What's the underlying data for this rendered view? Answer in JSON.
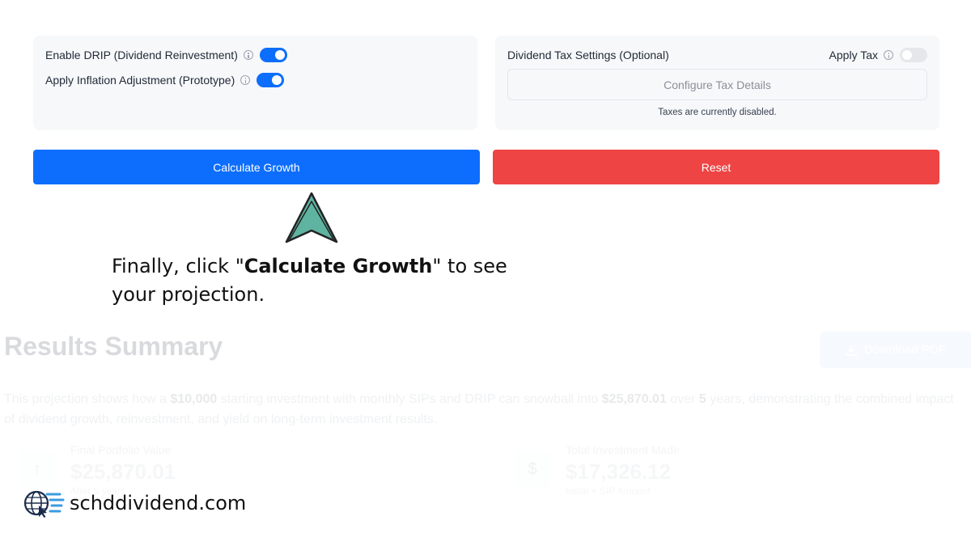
{
  "options": {
    "drip_label": "Enable DRIP (Dividend Reinvestment)",
    "drip_enabled": true,
    "inflation_label": "Apply Inflation Adjustment (Prototype)",
    "inflation_enabled": true
  },
  "tax": {
    "title": "Dividend Tax Settings (Optional)",
    "apply_label": "Apply Tax",
    "apply_enabled": false,
    "configure_label": "Configure Tax Details",
    "status": "Taxes are currently disabled."
  },
  "actions": {
    "calculate_label": "Calculate Growth",
    "reset_label": "Reset"
  },
  "hint": {
    "prefix": "Finally, click \"",
    "bold": "Calculate Growth",
    "suffix": "\" to see your projection."
  },
  "results": {
    "title": "Results Summary",
    "download_label": "Download PDF",
    "summary_1": "This projection shows how a ",
    "summary_amount_start": "$10,000",
    "summary_2": " starting investment with monthly SIPs and DRIP can snowball into ",
    "summary_amount_end": "$25,870.01",
    "summary_3": " over ",
    "summary_years": "5",
    "summary_4": " years, demonstrating the combined impact of dividend growth, reinvestment, and yield on long-term investment results.",
    "cards": [
      {
        "label": "Final Portfolio Value",
        "value": "$25,870.01",
        "sub": "After 5 years",
        "icon": "arrow-up-icon"
      },
      {
        "label": "Total Investment Made",
        "value": "$17,326.12",
        "sub": "Initial + SIP Amount",
        "icon": "dollar-icon"
      }
    ]
  },
  "watermark": {
    "text": "schddividend.com"
  },
  "colors": {
    "primary": "#0d6efd",
    "danger": "#ef4444",
    "pointer": "#5fb3a1"
  }
}
